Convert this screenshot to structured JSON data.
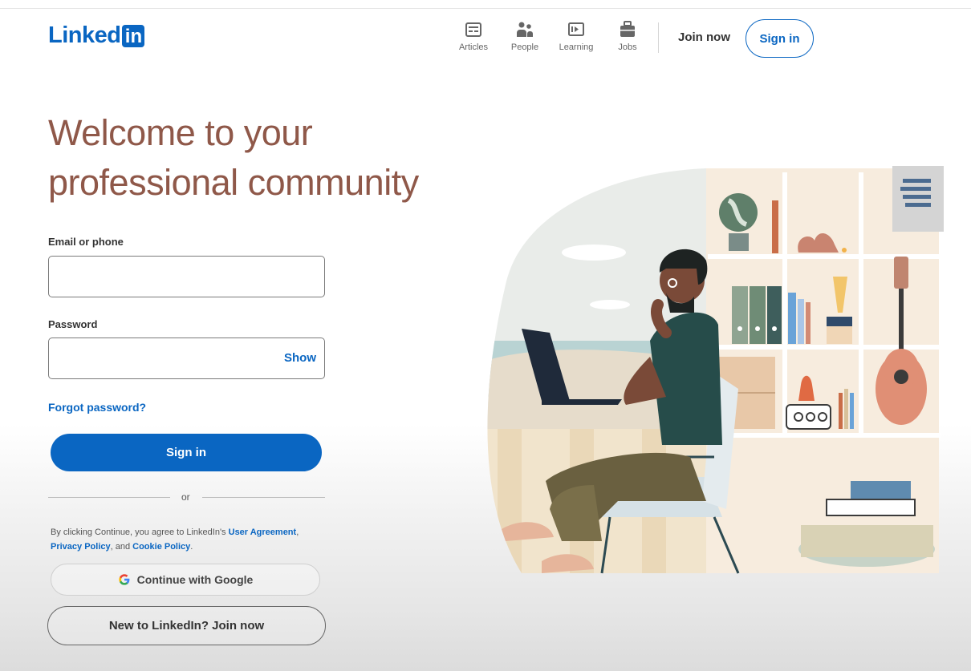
{
  "brand": {
    "logo_text": "Linked",
    "logo_box": "in",
    "color": "#0a66c2"
  },
  "nav": {
    "items": [
      {
        "label": "Articles",
        "icon": "articles-icon"
      },
      {
        "label": "People",
        "icon": "people-icon"
      },
      {
        "label": "Learning",
        "icon": "learning-icon"
      },
      {
        "label": "Jobs",
        "icon": "jobs-icon"
      }
    ],
    "join_now": "Join now",
    "sign_in": "Sign in"
  },
  "hero": {
    "headline_line1": "Welcome to your",
    "headline_line2": "professional community",
    "headline_color": "#8f5849"
  },
  "form": {
    "email_label": "Email or phone",
    "email_value": "",
    "password_label": "Password",
    "password_value": "",
    "show_label": "Show",
    "forgot_password": "Forgot password?",
    "sign_in_button": "Sign in",
    "or_text": "or",
    "legal": {
      "prefix": "By clicking Continue, you agree to LinkedIn's ",
      "user_agreement": "User Agreement",
      "sep1": ",",
      "privacy_policy": "Privacy Policy",
      "sep2": ", and ",
      "cookie_policy": "Cookie Policy",
      "suffix": "."
    },
    "google_button": "Continue with Google",
    "join_button": "New to LinkedIn? Join now"
  }
}
